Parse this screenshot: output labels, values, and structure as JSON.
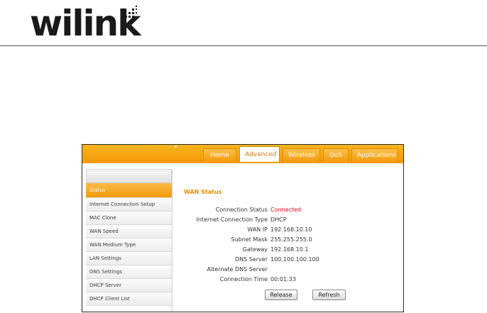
{
  "brand": {
    "logo_text": "wilink"
  },
  "nav": {
    "tabs": [
      {
        "label": "Home"
      },
      {
        "label": "Advanced"
      },
      {
        "label": "Wireless"
      },
      {
        "label": "QoS"
      },
      {
        "label": "Applications"
      }
    ],
    "active_tab": "Advanced"
  },
  "sidebar": {
    "items": [
      {
        "label": "Status"
      },
      {
        "label": "Internet Connection Setup"
      },
      {
        "label": "MAC Clone"
      },
      {
        "label": "WAN Speed"
      },
      {
        "label": "WAN Medium Type"
      },
      {
        "label": "LAN Settings"
      },
      {
        "label": "DNS Settings"
      },
      {
        "label": "DHCP Server"
      },
      {
        "label": "DHCP Client List"
      }
    ],
    "active_item": "Status"
  },
  "wan_status": {
    "title": "WAN Status",
    "rows": [
      {
        "label": "Connection Status",
        "value": "Connected"
      },
      {
        "label": "Internet Connection Type",
        "value": "DHCP"
      },
      {
        "label": "WAN IP",
        "value": "192.168.10.10"
      },
      {
        "label": "Subnet Mask",
        "value": "255.255.255.0"
      },
      {
        "label": "Gateway",
        "value": "192.168.10.1"
      },
      {
        "label": "DNS Server",
        "value": "100.100.100.100"
      },
      {
        "label": "Alternate DNS Server",
        "value": ""
      },
      {
        "label": "Connection Time",
        "value": "00:01:33"
      }
    ]
  },
  "buttons": {
    "release": "Release",
    "refresh": "Refresh"
  },
  "colors": {
    "accent": "#f39a08",
    "status_connected": "#e3001b",
    "title": "#e38b00"
  }
}
